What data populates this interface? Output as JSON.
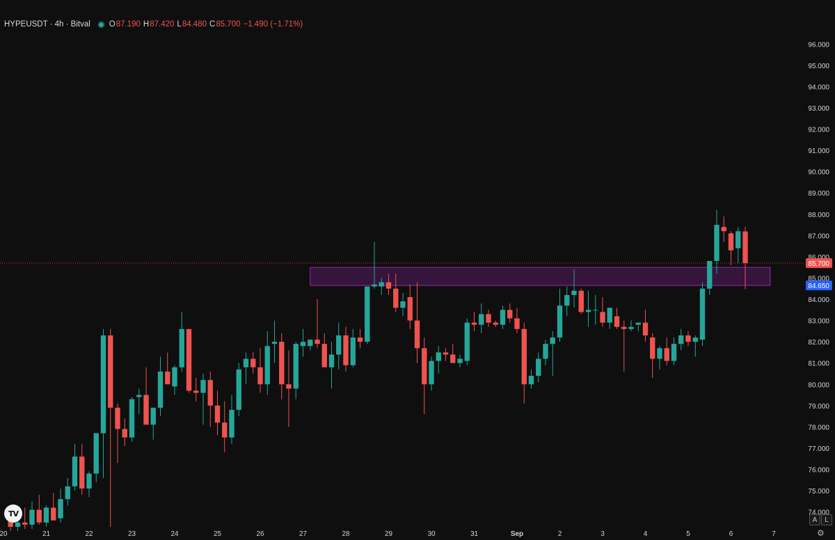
{
  "header": {
    "symbol": "HYPEUSDT · 4h · Bitval",
    "o_label": "O",
    "o_value": "87.190",
    "h_label": "H",
    "h_value": "87.420",
    "l_label": "L",
    "l_value": "84.480",
    "c_label": "C",
    "c_value": "85.700",
    "change": "−1.490 (−1.71%)"
  },
  "logo_text": "TV",
  "buttons": {
    "auto": "A",
    "log": "L"
  },
  "icons": {
    "settings": "gear-icon",
    "status": "status-dot-icon",
    "logo": "tradingview-logo-icon"
  },
  "colors": {
    "background": "#0f0f0f",
    "up": "#26a69a",
    "down": "#ef5350",
    "zone": "#9c27b0",
    "price_line": "#ef5350",
    "zone_label": "#2962ff"
  },
  "chart_data": {
    "type": "candlestick",
    "title": "HYPEUSDT · 4h · Bitval",
    "y_ticks": [
      "74.000",
      "75.000",
      "76.000",
      "77.000",
      "78.000",
      "79.000",
      "80.000",
      "81.000",
      "82.000",
      "83.000",
      "84.000",
      "85.000",
      "86.000",
      "87.000",
      "88.000",
      "89.000",
      "90.000",
      "91.000",
      "92.000",
      "93.000",
      "94.000",
      "95.000",
      "96.000"
    ],
    "x_ticks": [
      {
        "label": "20",
        "x": 0
      },
      {
        "label": "21",
        "x": 6
      },
      {
        "label": "22",
        "x": 12
      },
      {
        "label": "23",
        "x": 18
      },
      {
        "label": "24",
        "x": 24
      },
      {
        "label": "25",
        "x": 30
      },
      {
        "label": "26",
        "x": 36
      },
      {
        "label": "27",
        "x": 42
      },
      {
        "label": "28",
        "x": 48
      },
      {
        "label": "29",
        "x": 54
      },
      {
        "label": "30",
        "x": 60
      },
      {
        "label": "31",
        "x": 66
      },
      {
        "label": "Sep",
        "x": 72,
        "bold": true
      },
      {
        "label": "2",
        "x": 78
      },
      {
        "label": "3",
        "x": 84
      },
      {
        "label": "4",
        "x": 90
      },
      {
        "label": "5",
        "x": 96
      },
      {
        "label": "6",
        "x": 102
      },
      {
        "label": "7",
        "x": 108
      }
    ],
    "ylim": [
      73.3,
      96.6
    ],
    "xlim": [
      0,
      112
    ],
    "last_price": {
      "value": 85.7,
      "label": "85.700"
    },
    "zone": {
      "from_x": 43,
      "to_x": 107.5,
      "top": 85.5,
      "bottom": 84.65,
      "label": "84.650"
    },
    "candles": [
      {
        "x": 1,
        "o": 73.6,
        "h": 74.1,
        "l": 73.1,
        "c": 73.3
      },
      {
        "x": 2,
        "o": 73.3,
        "h": 73.7,
        "l": 73.1,
        "c": 73.5
      },
      {
        "x": 3,
        "o": 73.5,
        "h": 74.2,
        "l": 73.2,
        "c": 73.4
      },
      {
        "x": 4,
        "o": 73.4,
        "h": 74.5,
        "l": 73.2,
        "c": 74.1
      },
      {
        "x": 5,
        "o": 74.1,
        "h": 74.8,
        "l": 73.4,
        "c": 73.5
      },
      {
        "x": 6,
        "o": 73.5,
        "h": 74.3,
        "l": 73.3,
        "c": 74.2
      },
      {
        "x": 7,
        "o": 74.2,
        "h": 74.9,
        "l": 73.6,
        "c": 73.6
      },
      {
        "x": 8,
        "o": 73.7,
        "h": 75.1,
        "l": 73.5,
        "c": 74.6
      },
      {
        "x": 9,
        "o": 74.6,
        "h": 75.6,
        "l": 74.3,
        "c": 75.2
      },
      {
        "x": 10,
        "o": 75.2,
        "h": 77.2,
        "l": 75.0,
        "c": 76.6
      },
      {
        "x": 11,
        "o": 76.6,
        "h": 77.2,
        "l": 74.8,
        "c": 75.1
      },
      {
        "x": 12,
        "o": 75.1,
        "h": 75.9,
        "l": 74.7,
        "c": 75.8
      },
      {
        "x": 13,
        "o": 75.8,
        "h": 76.9,
        "l": 75.4,
        "c": 77.7
      },
      {
        "x": 14,
        "o": 77.7,
        "h": 82.6,
        "l": 75.6,
        "c": 82.3
      },
      {
        "x": 15,
        "o": 82.3,
        "h": 82.6,
        "l": 73.3,
        "c": 78.9
      },
      {
        "x": 16,
        "o": 78.9,
        "h": 79.1,
        "l": 76.3,
        "c": 77.9
      },
      {
        "x": 17,
        "o": 77.9,
        "h": 78.4,
        "l": 77.1,
        "c": 77.5
      },
      {
        "x": 18,
        "o": 77.5,
        "h": 79.4,
        "l": 77.3,
        "c": 79.3
      },
      {
        "x": 19,
        "o": 79.4,
        "h": 79.8,
        "l": 78.6,
        "c": 79.5
      },
      {
        "x": 20,
        "o": 79.5,
        "h": 80.8,
        "l": 78.3,
        "c": 78.1
      },
      {
        "x": 21,
        "o": 78.1,
        "h": 78.9,
        "l": 77.4,
        "c": 78.9
      },
      {
        "x": 22,
        "o": 78.9,
        "h": 81.3,
        "l": 78.5,
        "c": 80.6
      },
      {
        "x": 23,
        "o": 80.6,
        "h": 81.5,
        "l": 80.2,
        "c": 80.0
      },
      {
        "x": 24,
        "o": 79.9,
        "h": 80.9,
        "l": 79.5,
        "c": 80.8
      },
      {
        "x": 25,
        "o": 80.8,
        "h": 83.4,
        "l": 80.6,
        "c": 82.6
      },
      {
        "x": 26,
        "o": 82.6,
        "h": 82.6,
        "l": 79.6,
        "c": 79.7
      },
      {
        "x": 27,
        "o": 79.7,
        "h": 80.3,
        "l": 79.2,
        "c": 79.6
      },
      {
        "x": 28,
        "o": 79.6,
        "h": 80.5,
        "l": 78.1,
        "c": 80.2
      },
      {
        "x": 29,
        "o": 80.2,
        "h": 80.6,
        "l": 78.0,
        "c": 79.0
      },
      {
        "x": 30,
        "o": 79.0,
        "h": 79.7,
        "l": 77.6,
        "c": 78.2
      },
      {
        "x": 31,
        "o": 78.2,
        "h": 79.2,
        "l": 76.8,
        "c": 77.5
      },
      {
        "x": 32,
        "o": 77.5,
        "h": 79.5,
        "l": 77.2,
        "c": 78.8
      },
      {
        "x": 33,
        "o": 78.8,
        "h": 81.0,
        "l": 78.5,
        "c": 80.7
      },
      {
        "x": 34,
        "o": 80.8,
        "h": 81.5,
        "l": 80.0,
        "c": 81.2
      },
      {
        "x": 35,
        "o": 81.2,
        "h": 81.5,
        "l": 80.5,
        "c": 80.8
      },
      {
        "x": 36,
        "o": 80.8,
        "h": 81.7,
        "l": 79.6,
        "c": 80.0
      },
      {
        "x": 37,
        "o": 80.0,
        "h": 82.5,
        "l": 79.5,
        "c": 81.8
      },
      {
        "x": 38,
        "o": 81.9,
        "h": 83.0,
        "l": 81.0,
        "c": 82.0
      },
      {
        "x": 39,
        "o": 82.0,
        "h": 82.4,
        "l": 79.3,
        "c": 80.0
      },
      {
        "x": 40,
        "o": 80.0,
        "h": 81.6,
        "l": 78.0,
        "c": 79.8
      },
      {
        "x": 41,
        "o": 79.8,
        "h": 82.0,
        "l": 79.3,
        "c": 81.9
      },
      {
        "x": 42,
        "o": 81.8,
        "h": 82.6,
        "l": 81.3,
        "c": 82.0
      },
      {
        "x": 43,
        "o": 81.8,
        "h": 82.0,
        "l": 81.6,
        "c": 82.1
      },
      {
        "x": 44,
        "o": 82.1,
        "h": 84.0,
        "l": 81.7,
        "c": 81.9
      },
      {
        "x": 45,
        "o": 81.9,
        "h": 82.4,
        "l": 81.1,
        "c": 80.8
      },
      {
        "x": 46,
        "o": 80.8,
        "h": 82.0,
        "l": 79.8,
        "c": 81.4
      },
      {
        "x": 47,
        "o": 81.4,
        "h": 82.9,
        "l": 80.7,
        "c": 82.3
      },
      {
        "x": 48,
        "o": 82.3,
        "h": 82.7,
        "l": 80.6,
        "c": 80.9
      },
      {
        "x": 49,
        "o": 80.9,
        "h": 82.6,
        "l": 80.8,
        "c": 82.2
      },
      {
        "x": 50,
        "o": 82.2,
        "h": 82.6,
        "l": 81.7,
        "c": 82.0
      },
      {
        "x": 51,
        "o": 82.0,
        "h": 84.5,
        "l": 81.9,
        "c": 84.6
      },
      {
        "x": 52,
        "o": 84.6,
        "h": 86.7,
        "l": 84.5,
        "c": 84.7
      },
      {
        "x": 53,
        "o": 84.6,
        "h": 85.0,
        "l": 84.2,
        "c": 84.8
      },
      {
        "x": 54,
        "o": 84.8,
        "h": 85.2,
        "l": 84.2,
        "c": 84.5
      },
      {
        "x": 55,
        "o": 84.5,
        "h": 85.2,
        "l": 83.4,
        "c": 83.6
      },
      {
        "x": 56,
        "o": 83.6,
        "h": 84.3,
        "l": 83.2,
        "c": 83.9
      },
      {
        "x": 57,
        "o": 84.1,
        "h": 84.7,
        "l": 82.6,
        "c": 83.0
      },
      {
        "x": 58,
        "o": 83.0,
        "h": 84.8,
        "l": 81.0,
        "c": 81.7
      },
      {
        "x": 59,
        "o": 81.7,
        "h": 82.2,
        "l": 78.6,
        "c": 80.0
      },
      {
        "x": 60,
        "o": 80.0,
        "h": 81.3,
        "l": 79.7,
        "c": 81.1
      },
      {
        "x": 61,
        "o": 81.1,
        "h": 81.8,
        "l": 80.5,
        "c": 81.5
      },
      {
        "x": 62,
        "o": 81.5,
        "h": 81.7,
        "l": 81.1,
        "c": 81.4
      },
      {
        "x": 63,
        "o": 81.4,
        "h": 81.9,
        "l": 81.0,
        "c": 81.0
      },
      {
        "x": 64,
        "o": 81.0,
        "h": 81.4,
        "l": 80.8,
        "c": 81.2
      },
      {
        "x": 65,
        "o": 81.1,
        "h": 83.1,
        "l": 80.9,
        "c": 82.9
      },
      {
        "x": 66,
        "o": 82.9,
        "h": 83.4,
        "l": 82.5,
        "c": 82.8
      },
      {
        "x": 67,
        "o": 82.8,
        "h": 83.8,
        "l": 82.4,
        "c": 83.3
      },
      {
        "x": 68,
        "o": 83.3,
        "h": 83.5,
        "l": 82.7,
        "c": 82.9
      },
      {
        "x": 69,
        "o": 82.9,
        "h": 83.0,
        "l": 82.7,
        "c": 82.8
      },
      {
        "x": 70,
        "o": 82.8,
        "h": 83.7,
        "l": 82.6,
        "c": 83.5
      },
      {
        "x": 71,
        "o": 83.5,
        "h": 83.8,
        "l": 82.9,
        "c": 83.1
      },
      {
        "x": 72,
        "o": 83.1,
        "h": 83.6,
        "l": 82.4,
        "c": 82.6
      },
      {
        "x": 73,
        "o": 82.6,
        "h": 82.9,
        "l": 79.1,
        "c": 80.0
      },
      {
        "x": 74,
        "o": 80.0,
        "h": 80.7,
        "l": 79.8,
        "c": 80.4
      },
      {
        "x": 75,
        "o": 80.4,
        "h": 81.5,
        "l": 80.1,
        "c": 81.2
      },
      {
        "x": 76,
        "o": 81.2,
        "h": 82.1,
        "l": 80.9,
        "c": 81.9
      },
      {
        "x": 77,
        "o": 81.9,
        "h": 82.5,
        "l": 80.4,
        "c": 82.2
      },
      {
        "x": 78,
        "o": 82.2,
        "h": 84.5,
        "l": 82.0,
        "c": 83.7
      },
      {
        "x": 79,
        "o": 83.7,
        "h": 84.6,
        "l": 83.2,
        "c": 84.2
      },
      {
        "x": 80,
        "o": 84.2,
        "h": 85.4,
        "l": 83.6,
        "c": 84.4
      },
      {
        "x": 81,
        "o": 84.4,
        "h": 84.5,
        "l": 83.3,
        "c": 83.4
      },
      {
        "x": 82,
        "o": 83.4,
        "h": 84.4,
        "l": 82.7,
        "c": 83.5
      },
      {
        "x": 83,
        "o": 83.5,
        "h": 84.2,
        "l": 82.8,
        "c": 83.5
      },
      {
        "x": 84,
        "o": 83.4,
        "h": 84.1,
        "l": 82.7,
        "c": 82.9
      },
      {
        "x": 85,
        "o": 82.9,
        "h": 83.5,
        "l": 82.6,
        "c": 83.6
      },
      {
        "x": 86,
        "o": 83.2,
        "h": 83.6,
        "l": 82.6,
        "c": 82.7
      },
      {
        "x": 87,
        "o": 82.7,
        "h": 83.0,
        "l": 80.6,
        "c": 82.6
      },
      {
        "x": 88,
        "o": 82.6,
        "h": 83.0,
        "l": 82.5,
        "c": 82.7
      },
      {
        "x": 89,
        "o": 82.8,
        "h": 82.9,
        "l": 82.5,
        "c": 82.9
      },
      {
        "x": 90,
        "o": 82.9,
        "h": 83.5,
        "l": 82.0,
        "c": 82.3
      },
      {
        "x": 91,
        "o": 82.2,
        "h": 82.4,
        "l": 80.3,
        "c": 81.2
      },
      {
        "x": 92,
        "o": 81.2,
        "h": 81.8,
        "l": 80.7,
        "c": 81.7
      },
      {
        "x": 93,
        "o": 81.7,
        "h": 82.2,
        "l": 80.9,
        "c": 81.1
      },
      {
        "x": 94,
        "o": 81.1,
        "h": 82.2,
        "l": 80.9,
        "c": 81.9
      },
      {
        "x": 95,
        "o": 81.9,
        "h": 82.6,
        "l": 81.6,
        "c": 82.3
      },
      {
        "x": 96,
        "o": 82.3,
        "h": 82.5,
        "l": 81.8,
        "c": 82.0
      },
      {
        "x": 97,
        "o": 82.0,
        "h": 82.3,
        "l": 81.3,
        "c": 82.2
      },
      {
        "x": 98,
        "o": 82.1,
        "h": 84.8,
        "l": 81.8,
        "c": 84.5
      },
      {
        "x": 99,
        "o": 84.5,
        "h": 85.6,
        "l": 84.2,
        "c": 85.8
      },
      {
        "x": 100,
        "o": 85.8,
        "h": 88.2,
        "l": 85.2,
        "c": 87.5
      },
      {
        "x": 101,
        "o": 87.4,
        "h": 87.9,
        "l": 86.7,
        "c": 87.2
      },
      {
        "x": 102,
        "o": 87.1,
        "h": 87.2,
        "l": 85.6,
        "c": 86.3
      },
      {
        "x": 103,
        "o": 86.4,
        "h": 87.4,
        "l": 85.7,
        "c": 87.2
      },
      {
        "x": 104,
        "o": 87.19,
        "h": 87.42,
        "l": 84.48,
        "c": 85.7
      }
    ]
  }
}
